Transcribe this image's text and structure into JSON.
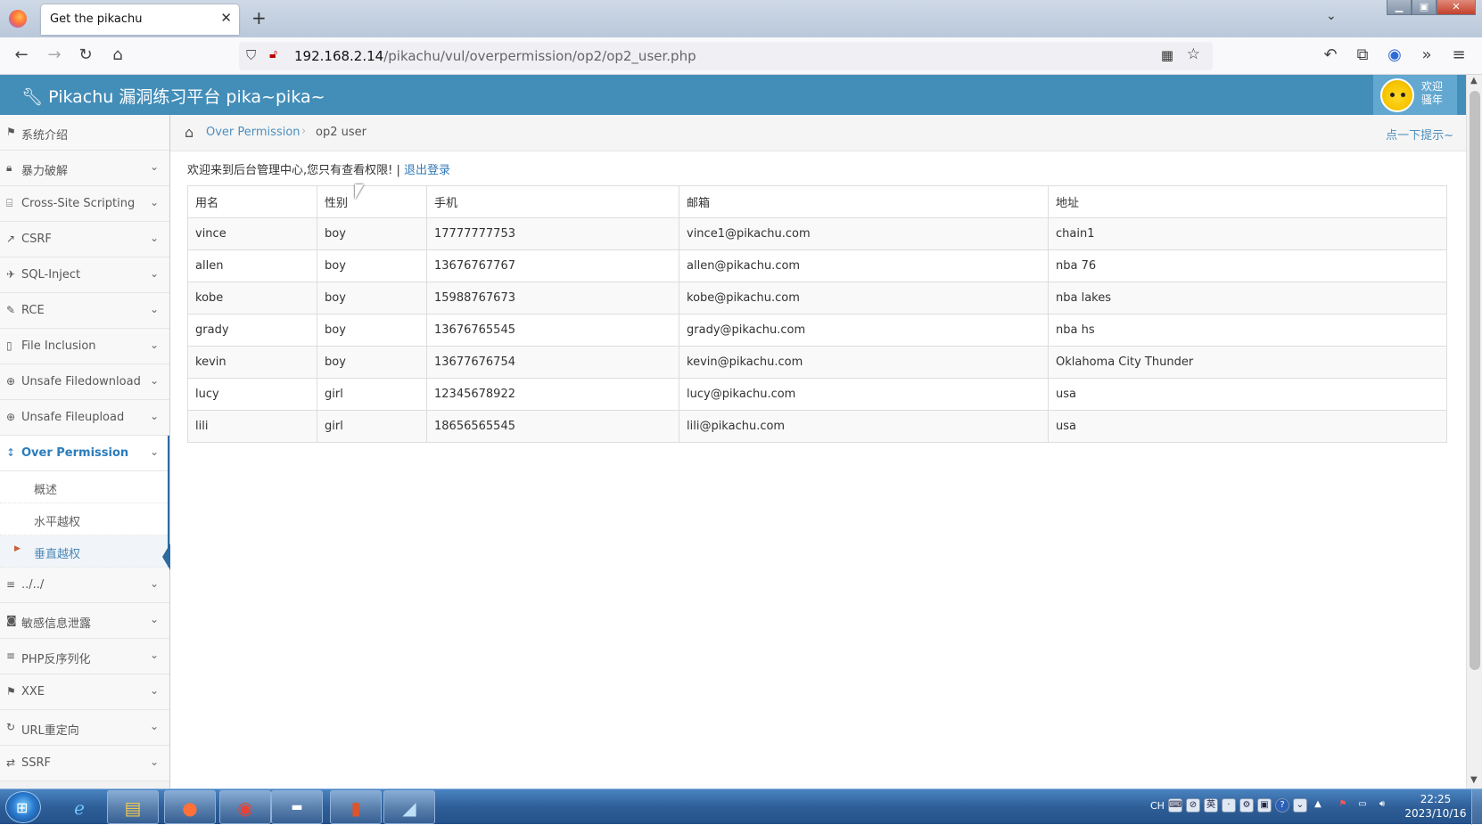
{
  "browser": {
    "tab_title": "Get the pikachu",
    "tab_close": "✕",
    "new_tab": "+",
    "tab_list": "⌄",
    "window_buttons": [
      "▁",
      "▣",
      "✕"
    ],
    "url_host": "192.168.2.14",
    "url_path": "/pikachu/vul/overpermission/op2/op2_user.php",
    "icons": [
      "firefox-logo-icon",
      "back-arrow-icon",
      "forward-arrow-icon",
      "reload-icon",
      "home-icon",
      "shield-icon",
      "lock-insecure-icon",
      "qr-code-icon",
      "bookmark-star-icon",
      "share-back-icon",
      "extensions-icon",
      "account-icon",
      "overflow-chevron-icon",
      "menu-hamburger-icon"
    ]
  },
  "site": {
    "title": "Pikachu 漏洞练习平台 pika~pika~",
    "welcome": "欢迎 骚年",
    "accent": "#438eb9"
  },
  "sidebar": {
    "items": [
      {
        "label": "系统介绍",
        "icon": "tag-icon",
        "has_chevron": false
      },
      {
        "label": "暴力破解",
        "icon": "lock-icon",
        "has_chevron": true
      },
      {
        "label": "Cross-Site Scripting",
        "icon": "code-icon",
        "has_chevron": true
      },
      {
        "label": "CSRF",
        "icon": "external-link-icon",
        "has_chevron": true
      },
      {
        "label": "SQL-Inject",
        "icon": "fighter-jet-icon",
        "has_chevron": true
      },
      {
        "label": "RCE",
        "icon": "pencil-icon",
        "has_chevron": true
      },
      {
        "label": "File Inclusion",
        "icon": "file-icon",
        "has_chevron": true
      },
      {
        "label": "Unsafe Filedownload",
        "icon": "download-circle-icon",
        "has_chevron": true
      },
      {
        "label": "Unsafe Fileupload",
        "icon": "upload-circle-icon",
        "has_chevron": true
      },
      {
        "label": "Over Permission",
        "icon": "text-height-icon",
        "has_chevron": true
      },
      {
        "label": "../../",
        "icon": "align-justify-icon",
        "has_chevron": true
      },
      {
        "label": "敏感信息泄露",
        "icon": "camera-icon",
        "has_chevron": true
      },
      {
        "label": "PHP反序列化",
        "icon": "align-justify-icon",
        "has_chevron": true
      },
      {
        "label": "XXE",
        "icon": "flag-icon",
        "has_chevron": true
      },
      {
        "label": "URL重定向",
        "icon": "refresh-icon",
        "has_chevron": true
      },
      {
        "label": "SSRF",
        "icon": "exchange-icon",
        "has_chevron": true
      }
    ],
    "active_index": 9,
    "sub_items": [
      "概述",
      "水平越权",
      "垂直越权"
    ],
    "current_sub_index": 2
  },
  "breadcrumb": {
    "section": "Over Permission",
    "current": "op2 user",
    "hint": "点一下提示~"
  },
  "main": {
    "intro_text": "欢迎来到后台管理中心,您只有查看权限! | ",
    "logout_label": "退出登录",
    "table": {
      "headers": [
        "用名",
        "性别",
        "手机",
        "邮箱",
        "地址"
      ],
      "rows": [
        [
          "vince",
          "boy",
          "17777777753",
          "vince1@pikachu.com",
          "chain1"
        ],
        [
          "allen",
          "boy",
          "13676767767",
          "allen@pikachu.com",
          "nba 76"
        ],
        [
          "kobe",
          "boy",
          "15988767673",
          "kobe@pikachu.com",
          "nba lakes"
        ],
        [
          "grady",
          "boy",
          "13676765545",
          "grady@pikachu.com",
          "nba hs"
        ],
        [
          "kevin",
          "boy",
          "13677676754",
          "kevin@pikachu.com",
          "Oklahoma City Thunder"
        ],
        [
          "lucy",
          "girl",
          "12345678922",
          "lucy@pikachu.com",
          "usa"
        ],
        [
          "lili",
          "girl",
          "18656565545",
          "lili@pikachu.com",
          "usa"
        ]
      ]
    }
  },
  "taskbar": {
    "apps": [
      "internet-explorer-icon",
      "file-explorer-icon",
      "firefox-icon",
      "chrome-icon",
      "terminal-icon",
      "office-icon",
      "notepad-icon"
    ],
    "lang": "CH",
    "time": "22:25",
    "date": "2023/10/16"
  }
}
